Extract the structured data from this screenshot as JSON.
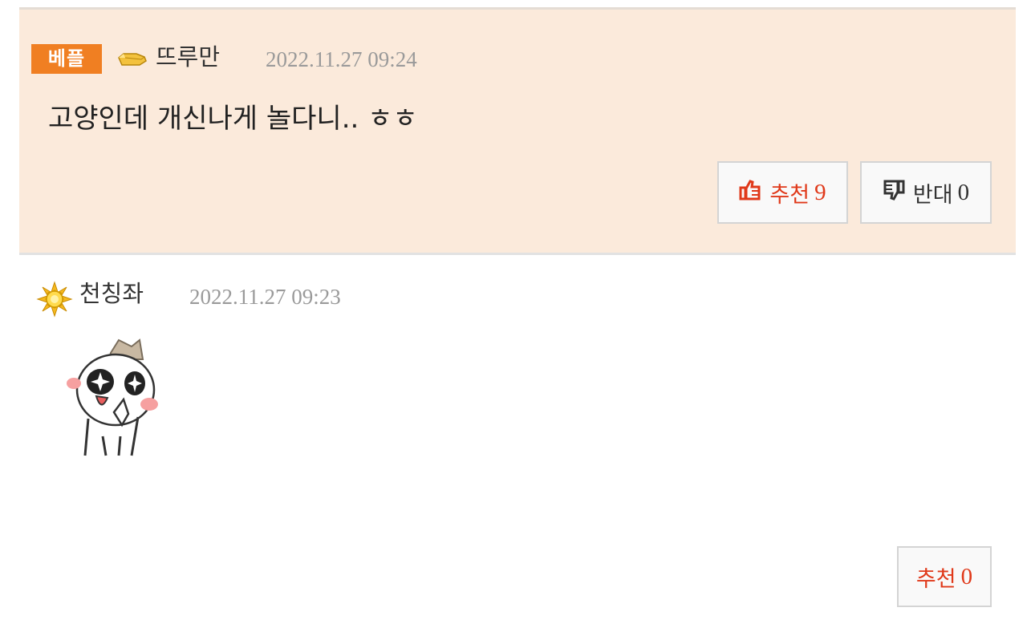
{
  "comments": [
    {
      "badge": "베플",
      "nickname": "뜨루만",
      "level_icon": "gold-bar-icon",
      "date": "2022.11.27 09:24",
      "text": "고양인데 개신나게 놀다니.. ㅎㅎ",
      "recommend_label": "추천",
      "recommend_count": "9",
      "oppose_label": "반대",
      "oppose_count": "0"
    },
    {
      "nickname": "천칭좌",
      "level_icon": "sun-flower-icon",
      "date": "2022.11.27 09:23",
      "sticker": "star-eyed-character-sticker",
      "recommend_label": "추천",
      "recommend_count": "0"
    }
  ],
  "colors": {
    "best_bg": "#fbeadb",
    "badge_bg": "#f07f22",
    "recommend": "#e0391a"
  }
}
